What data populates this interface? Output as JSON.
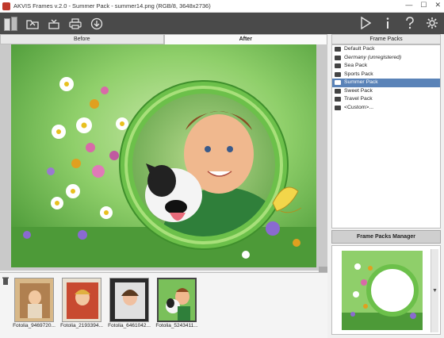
{
  "window": {
    "title": "AKVIS Frames v.2.0 - Summer Pack - summer14.png (RGB/8, 3648x2736)",
    "min": "—",
    "max": "☐",
    "close": "✕"
  },
  "toolbar": {
    "icons": [
      "app-logo-icon",
      "open-icon",
      "save-icon",
      "print-icon",
      "share-icon",
      "run-icon",
      "info-icon",
      "help-icon",
      "settings-icon"
    ]
  },
  "tabs": {
    "before": "Before",
    "after": "After"
  },
  "filmstrip": {
    "items": [
      {
        "caption": "Fotolia_9469720..."
      },
      {
        "caption": "Fotolia_2193394..."
      },
      {
        "caption": "Fotolia_6461042..."
      },
      {
        "caption": "Fotolia_5243411..."
      }
    ]
  },
  "packs_panel": {
    "header": "Frame Packs",
    "items": [
      {
        "label": "Default Pack",
        "selected": false,
        "unregistered": false
      },
      {
        "label": "Germany (unregistered)",
        "selected": false,
        "unregistered": true
      },
      {
        "label": "Sea Pack",
        "selected": false,
        "unregistered": false
      },
      {
        "label": "Sports Pack",
        "selected": false,
        "unregistered": false
      },
      {
        "label": "Summer Pack",
        "selected": true,
        "unregistered": false
      },
      {
        "label": "Sweet Pack",
        "selected": false,
        "unregistered": false
      },
      {
        "label": "Travel Pack",
        "selected": false,
        "unregistered": false
      },
      {
        "label": "<Custom>...",
        "selected": false,
        "unregistered": false
      }
    ],
    "manager_button": "Frame Packs Manager"
  },
  "colors": {
    "toolbar": "#4a4a4a",
    "selection": "#5a83b8",
    "frame_green": "#6cc04a"
  }
}
